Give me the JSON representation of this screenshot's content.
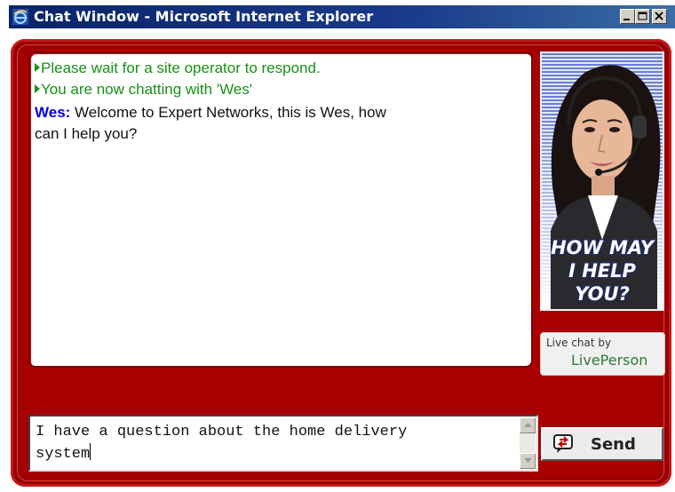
{
  "window": {
    "title": "Chat Window - Microsoft Internet Explorer",
    "controls": [
      "minimize",
      "maximize",
      "close"
    ]
  },
  "transcript": {
    "messages": [
      {
        "type": "system",
        "text": "Please wait for a site operator to respond."
      },
      {
        "type": "system",
        "text": "You are now chatting with 'Wes'"
      },
      {
        "type": "operator",
        "name": "Wes:",
        "text_line1": " Welcome to Expert Networks, this is Wes, how",
        "text_line2": "can I help you?"
      }
    ]
  },
  "agent_photo": {
    "banner": "HOW MAY I HELP YOU?"
  },
  "liveperson": {
    "caption": "Live chat by",
    "brand": "LivePerson"
  },
  "input": {
    "value_line1": "I have a question about the home delivery",
    "value_line2": "system"
  },
  "send_button": {
    "label": "Send"
  },
  "colors": {
    "frame_red": "#a80000",
    "system_text": "#189018",
    "operator_name": "#0000dd",
    "titlebar": "#0a246a"
  }
}
